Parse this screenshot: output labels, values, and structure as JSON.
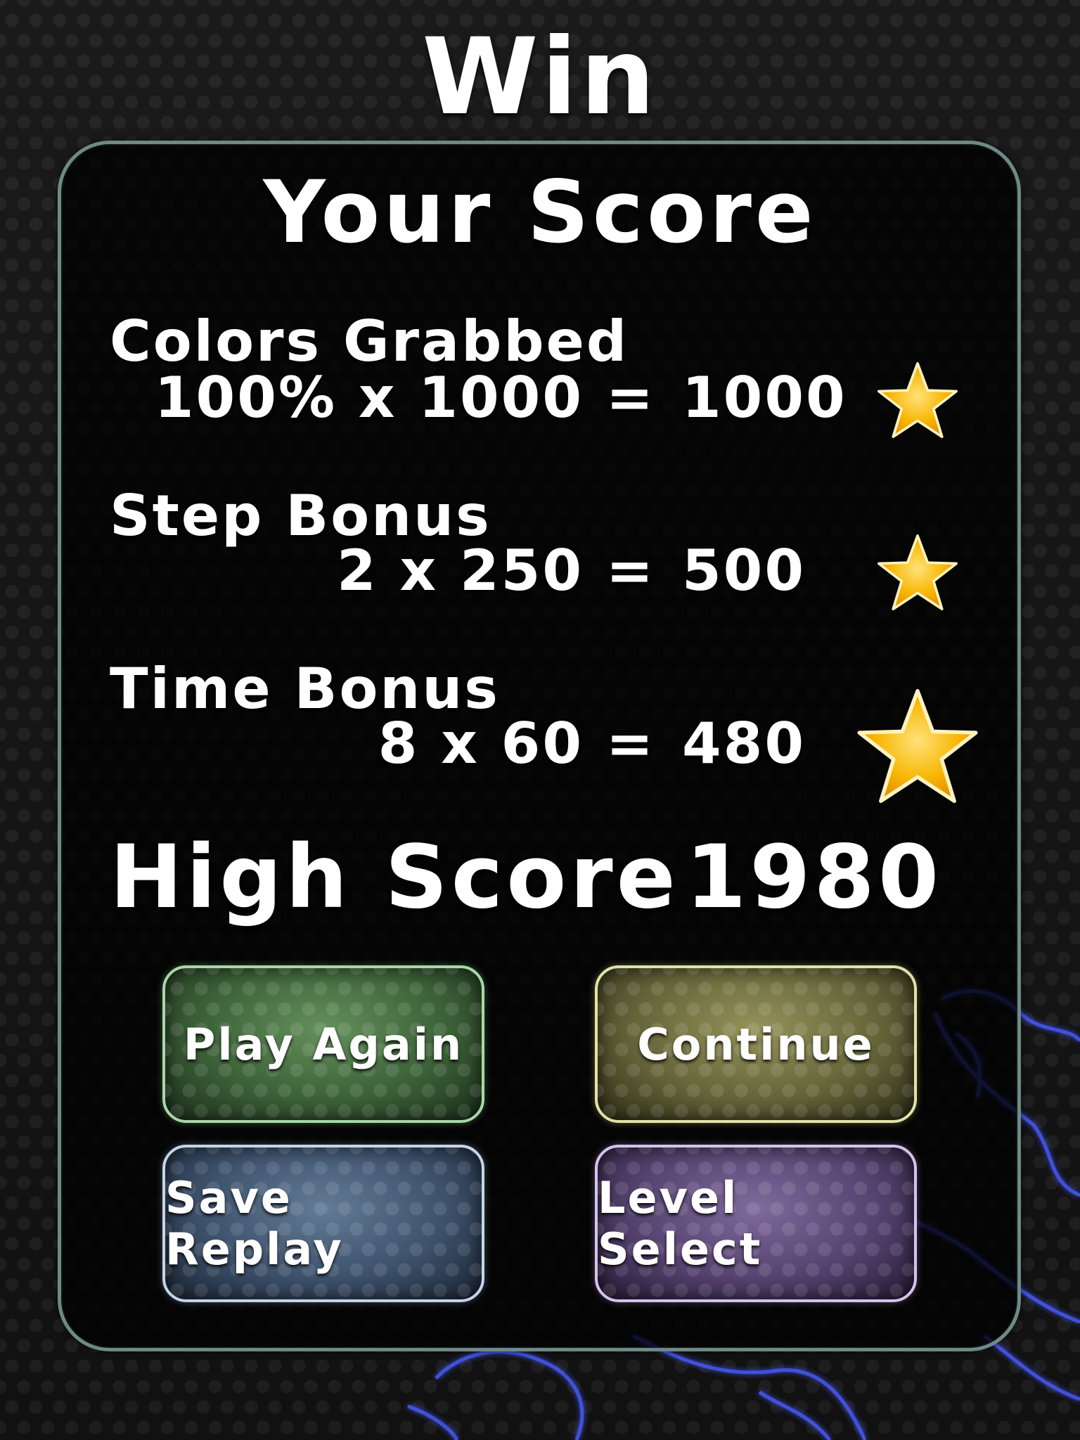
{
  "title": "Win",
  "panel": {
    "heading": "Your Score",
    "rows": [
      {
        "label": "Colors Grabbed",
        "expression": "100% x 1000",
        "equals": "=",
        "result": "1000",
        "star_icon": "star-icon"
      },
      {
        "label": "Step Bonus",
        "expression": "2 x 250",
        "equals": "=",
        "result": "500",
        "star_icon": "star-icon"
      },
      {
        "label": "Time Bonus",
        "expression": "8 x 60",
        "equals": "=",
        "result": "480",
        "star_icon": "star-icon"
      }
    ],
    "high_score": {
      "label": "High Score",
      "value": "1980"
    }
  },
  "buttons": {
    "play_again": "Play Again",
    "continue": "Continue",
    "save_replay": "Save Replay",
    "level_select": "Level Select"
  },
  "colors": {
    "star_fill": "#f7b500",
    "panel_border": "#6f8a86",
    "play_again": "#3c6138",
    "continue": "#656439",
    "save_replay": "#3d516b",
    "level_select": "#55426f"
  }
}
